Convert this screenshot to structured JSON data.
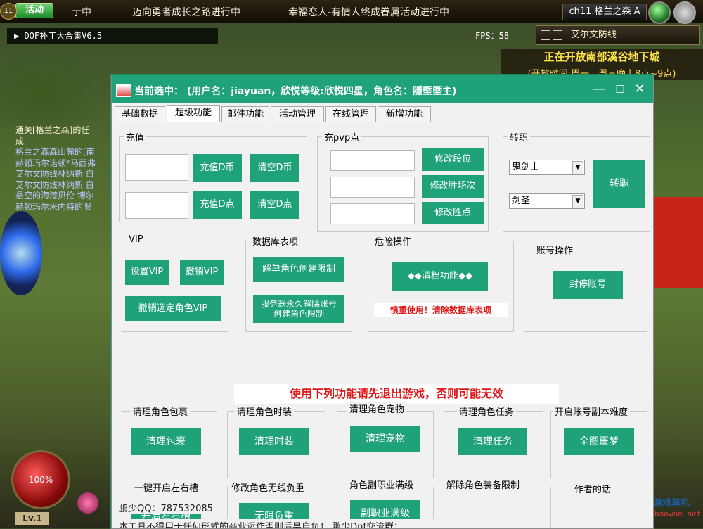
{
  "game": {
    "activity_btn": "活动",
    "top_ticker_1": "亍中",
    "top_ticker_2": "迈向勇者成长之路进行中",
    "top_ticker_3": "幸福恋人-有情人终成眷属活动进行中",
    "channel": "ch11.格兰之森 A",
    "patch_title": "▶ DOF补丁大合集V6.5",
    "fps": "FPS：58",
    "map_name": "艾尔文防线",
    "dungeon_notice": "正在开放南部溪谷地下城",
    "dungeon_time": "(开放时间:周一，周三晚上8点~9点)",
    "chat_lines": [
      "通关[格兰之森]的任",
      "成",
      "格兰之森森山麓的[南",
      "赫顿玛尔诺顿*马西弗",
      "艾尔文防线林纳斯 白",
      "艾尔文防线林纳斯 白",
      "悬空的海港贝伦 博尔",
      "赫顿玛尔米内特的限"
    ],
    "hp_percent": "100%",
    "level": "Lv.1",
    "watermark_1": "藏宝湾游戏单机",
    "watermark_2": "www.cangbaowan.net",
    "colors": {
      "accent": "#1fa179",
      "warn": "#e01818"
    }
  },
  "window": {
    "title": "当前选中：  (用户名：jiayuan，欣悦等级:欣悦四星，角色名：隱塈塈主)",
    "min_icon": "minimize-icon",
    "max_icon": "maximize-icon",
    "close_icon": "close-icon"
  },
  "tabs": [
    "基础数据",
    "超级功能",
    "邮件功能",
    "活动管理",
    "在线管理",
    "新增功能"
  ],
  "active_tab": "超级功能",
  "recharge": {
    "title": "充值",
    "btn_charge_d": "充值D币",
    "btn_clear_d": "清空D币",
    "btn_charge_dian": "充值D点",
    "btn_clear_dian": "清空D点",
    "input_1": "",
    "input_2": ""
  },
  "pvp": {
    "title": "充pvp点",
    "btn_rank": "修改段位",
    "btn_wins_count": "修改胜场次",
    "btn_win_points": "修改胜点"
  },
  "job": {
    "title": "转职",
    "select_class": "鬼剑士",
    "select_sub": "剑圣",
    "btn": "转职"
  },
  "vip": {
    "title": "VIP",
    "btn_set": "设置VIP",
    "btn_cancel": "撤销VIP",
    "btn_cancel_selected": "撤销选定角色VIP"
  },
  "db": {
    "title": "数据库表项",
    "btn_unlock": "解单角色创建限制",
    "btn_server": "服务器永久解除账号创建角色限制"
  },
  "danger": {
    "title": "危险操作",
    "btn": "◆◆清档功能◆◆",
    "warning": "慎重使用！清除数据库表项"
  },
  "account": {
    "title": "账号操作",
    "btn": "封停账号"
  },
  "big_warning": "使用下列功能请先退出游戏，否则可能无效",
  "groups_row1": [
    {
      "title": "清理角色包裹",
      "btn": "清理包裹"
    },
    {
      "title": "清理角色时装",
      "btn": "清理时装"
    },
    {
      "title": "清理角色宠物",
      "btn": "清理宠物"
    },
    {
      "title": "清理角色任务",
      "btn": "清理任务"
    },
    {
      "title": "开启账号副本难度",
      "btn": "全图噩梦"
    }
  ],
  "groups_row2": [
    {
      "title": "一键开启左右槽",
      "btn": "开启左右槽"
    },
    {
      "title": "修改角色无线负重",
      "btn": "无限负重"
    },
    {
      "title": "角色副职业满级",
      "btn": "副职业满级"
    },
    {
      "title": "解除角色装备限制",
      "btn": ""
    },
    {
      "title": "作者的话",
      "btn": ""
    }
  ],
  "footer": {
    "qq": "鹏少QQ：787532085",
    "notice": "本工具不得用于任何形式的商业运作否则后果自负！ 鹏少Dnf交流群："
  }
}
